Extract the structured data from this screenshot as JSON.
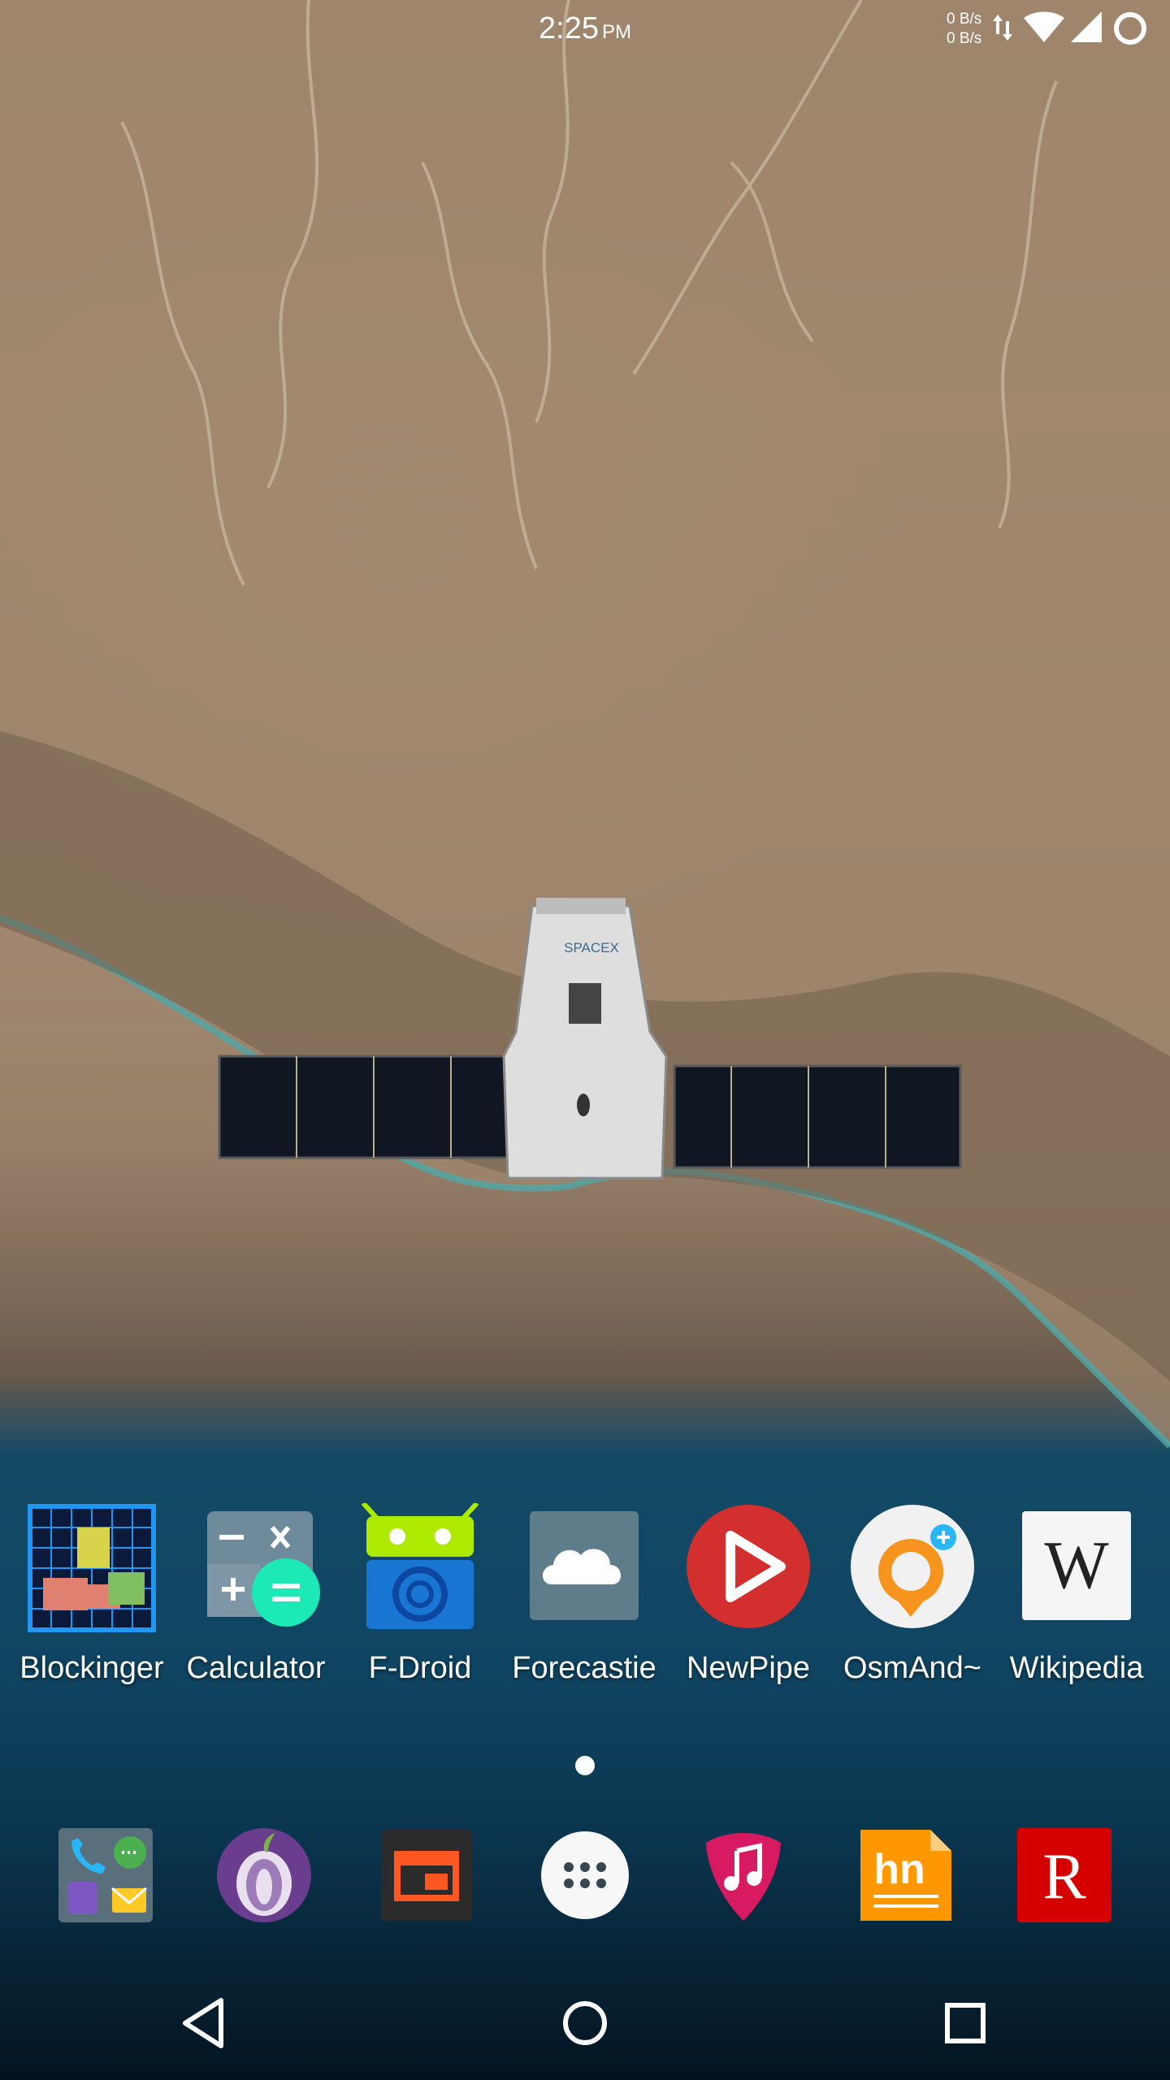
{
  "status_bar": {
    "time": "2:25",
    "ampm": "PM",
    "net_up": "0 B/s",
    "net_down": "0 B/s",
    "icons": [
      "data-transfer-icon",
      "wifi-icon",
      "signal-icon",
      "battery-icon"
    ]
  },
  "wallpaper": {
    "capsule_text": "SPACEX"
  },
  "apps": [
    {
      "label": "Blockinger",
      "icon": "blockinger-icon"
    },
    {
      "label": "Calculator",
      "icon": "calculator-icon"
    },
    {
      "label": "F-Droid",
      "icon": "fdroid-icon"
    },
    {
      "label": "Forecastie",
      "icon": "cloud-icon"
    },
    {
      "label": "NewPipe",
      "icon": "play-icon"
    },
    {
      "label": "OsmAnd~",
      "icon": "map-pin-icon"
    },
    {
      "label": "Wikipedia",
      "icon": "wikipedia-icon",
      "glyph": "W"
    }
  ],
  "page_indicator": {
    "current": 1,
    "total": 1
  },
  "dock": [
    {
      "name": "folder",
      "icon": "folder-icon"
    },
    {
      "name": "tor-browser",
      "icon": "onion-icon"
    },
    {
      "name": "reader",
      "icon": "window-icon"
    },
    {
      "name": "app-drawer",
      "icon": "app-drawer-icon"
    },
    {
      "name": "music",
      "icon": "guitar-pick-music-icon"
    },
    {
      "name": "hacker-news",
      "icon": "hn-icon",
      "glyph": "hn"
    },
    {
      "name": "reddit-r",
      "icon": "r-icon",
      "glyph": "R"
    }
  ],
  "navbar": [
    "back-icon",
    "home-icon",
    "recents-icon"
  ],
  "colors": {
    "newpipe_red": "#d32f2f",
    "osmand_orange": "#f7941d",
    "fdroid_green": "#aeea00",
    "fdroid_blue": "#1976d2",
    "forecastie_gray": "#5f7c8a",
    "hn_orange": "#ff9800",
    "r_red": "#d50000",
    "music_pink": "#d81b60"
  }
}
